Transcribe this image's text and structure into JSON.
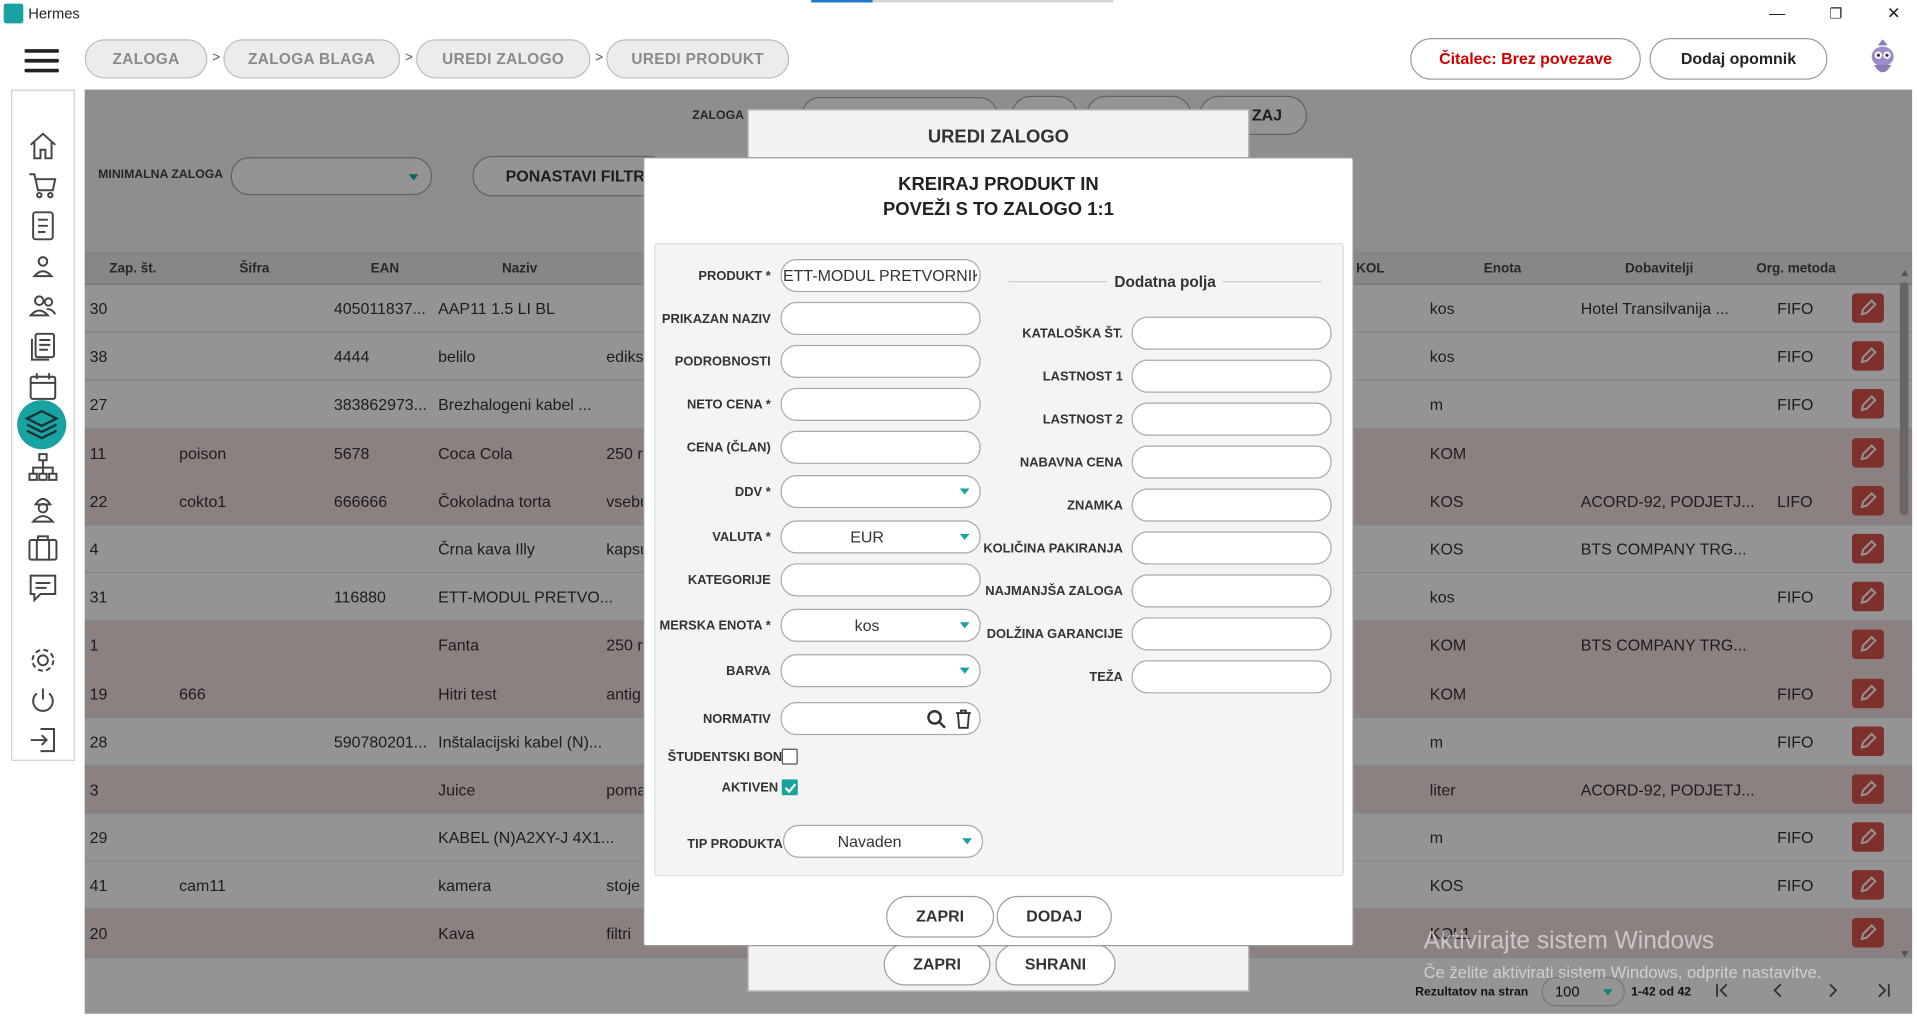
{
  "window": {
    "title": "Hermes",
    "minimize": "—",
    "restore": "❐",
    "close": "✕"
  },
  "breadcrumbs": [
    {
      "label": "ZALOGA"
    },
    {
      "label": "ZALOGA BLAGA"
    },
    {
      "label": "UREDI ZALOGO"
    },
    {
      "label": "UREDI PRODUKT"
    }
  ],
  "breadcrumb_separator": ">",
  "header": {
    "reader_status": "Čitalec: Brez povezave",
    "add_reminder": "Dodaj opomnik",
    "reader_status_color": "#d00000"
  },
  "sidebar_icons": [
    "home-icon",
    "cart-icon",
    "document-icon",
    "user-icon",
    "users-icon",
    "list-icon",
    "calendar-icon",
    "layers-icon",
    "network-icon",
    "worker-icon",
    "briefcase-icon",
    "chat-icon",
    "settings-icon",
    "power-icon",
    "logout-icon"
  ],
  "background_filters": {
    "zaloga_label": "ZALOGA P",
    "minimal_stock_label": "MINIMALNA ZALOGA",
    "reset_filters": "PONASTAVI FILTRE",
    "partial_button": "ZAJ"
  },
  "table": {
    "columns": [
      "Zap. št.",
      "Šifra",
      "EAN",
      "Naziv",
      "KOL",
      "Enota",
      "Dobavitelji",
      "Org. metoda"
    ],
    "rows": [
      {
        "no": "30",
        "sifra": "",
        "ean": "405011837...",
        "naziv": "AAP11 1.5 LI BL",
        "opis": "",
        "enota": "kos",
        "dob": "Hotel Transilvanija ...",
        "metoda": "FIFO",
        "pink": false
      },
      {
        "no": "38",
        "sifra": "",
        "ean": "4444",
        "naziv": "belilo",
        "opis": "ediks",
        "enota": "kos",
        "dob": "",
        "metoda": "FIFO",
        "pink": false
      },
      {
        "no": "27",
        "sifra": "",
        "ean": "383862973...",
        "naziv": "Brezhalogeni kabel ...",
        "opis": "",
        "enota": "m",
        "dob": "",
        "metoda": "FIFO",
        "pink": false
      },
      {
        "no": "11",
        "sifra": "poison",
        "ean": "5678",
        "naziv": "Coca Cola",
        "opis": "250 r",
        "enota": "KOM",
        "dob": "",
        "metoda": "",
        "pink": true
      },
      {
        "no": "22",
        "sifra": "cokto1",
        "ean": "666666",
        "naziv": "Čokoladna torta",
        "opis": "vsebu",
        "enota": "KOS",
        "dob": "ACORD-92, PODJETJ...",
        "metoda": "LIFO",
        "pink": true
      },
      {
        "no": "4",
        "sifra": "",
        "ean": "",
        "naziv": "Črna kava Illy",
        "opis": "kapsu",
        "enota": "KOS",
        "dob": "BTS COMPANY TRG...",
        "metoda": "",
        "pink": false
      },
      {
        "no": "31",
        "sifra": "",
        "ean": "116880",
        "naziv": "ETT-MODUL PRETVO...",
        "opis": "",
        "enota": "kos",
        "dob": "",
        "metoda": "FIFO",
        "pink": false
      },
      {
        "no": "1",
        "sifra": "",
        "ean": "",
        "naziv": "Fanta",
        "opis": "250 r",
        "enota": "KOM",
        "dob": "BTS COMPANY TRG...",
        "metoda": "",
        "pink": true
      },
      {
        "no": "19",
        "sifra": "666",
        "ean": "",
        "naziv": "Hitri test",
        "opis": "antig",
        "enota": "KOM",
        "dob": "",
        "metoda": "FIFO",
        "pink": true
      },
      {
        "no": "28",
        "sifra": "",
        "ean": "590780201...",
        "naziv": "Inštalacijski kabel (N)...",
        "opis": "",
        "enota": "m",
        "dob": "",
        "metoda": "FIFO",
        "pink": false
      },
      {
        "no": "3",
        "sifra": "",
        "ean": "",
        "naziv": "Juice",
        "opis": "poma",
        "enota": "liter",
        "dob": "ACORD-92, PODJETJ...",
        "metoda": "",
        "pink": true
      },
      {
        "no": "29",
        "sifra": "",
        "ean": "",
        "naziv": "KABEL (N)A2XY-J 4X1...",
        "opis": "",
        "enota": "m",
        "dob": "",
        "metoda": "FIFO",
        "pink": false
      },
      {
        "no": "41",
        "sifra": "cam11",
        "ean": "",
        "naziv": "kamera",
        "opis": "stoje",
        "enota": "KOS",
        "dob": "",
        "metoda": "FIFO",
        "pink": false
      },
      {
        "no": "20",
        "sifra": "",
        "ean": "",
        "naziv": "Kava",
        "opis": "filtri",
        "enota": "KOL1",
        "dob": "",
        "metoda": "",
        "pink": true
      }
    ]
  },
  "edit_stock_modal": {
    "title": "UREDI ZALOGO",
    "close": "ZAPRI",
    "save": "SHRANI"
  },
  "create_product_modal": {
    "title_line1": "KREIRAJ PRODUKT IN",
    "title_line2": "POVEŽI S TO ZALOGO 1:1",
    "left_fields": [
      {
        "label": "PRODUKT *",
        "value": "ETT-MODUL PRETVORNIK LE",
        "kind": "text"
      },
      {
        "label": "PRIKAZAN NAZIV",
        "value": "",
        "kind": "text"
      },
      {
        "label": "PODROBNOSTI",
        "value": "",
        "kind": "text"
      },
      {
        "label": "NETO CENA *",
        "value": "",
        "kind": "text"
      },
      {
        "label": "CENA (ČLAN)",
        "value": "",
        "kind": "text"
      },
      {
        "label": "DDV *",
        "value": "",
        "kind": "select"
      },
      {
        "label": "VALUTA *",
        "value": "EUR",
        "kind": "select"
      },
      {
        "label": "KATEGORIJE",
        "value": "",
        "kind": "text"
      },
      {
        "label": "MERSKA ENOTA *",
        "value": "kos",
        "kind": "select"
      },
      {
        "label": "BARVA",
        "value": "",
        "kind": "select"
      },
      {
        "label": "NORMATIV",
        "value": "",
        "kind": "search"
      }
    ],
    "student_voucher_label": "ŠTUDENTSKI BON",
    "student_voucher_checked": false,
    "active_label": "AKTIVEN",
    "active_checked": true,
    "product_type_label": "TIP PRODUKTA",
    "product_type_value": "Navaden",
    "extra_title": "Dodatna polja",
    "right_fields": [
      {
        "label": "KATALOŠKA ŠT.",
        "value": ""
      },
      {
        "label": "LASTNOST 1",
        "value": ""
      },
      {
        "label": "LASTNOST 2",
        "value": ""
      },
      {
        "label": "NABAVNA CENA",
        "value": ""
      },
      {
        "label": "ZNAMKA",
        "value": ""
      },
      {
        "label": "KOLIČINA PAKIRANJA",
        "value": ""
      },
      {
        "label": "NAJMANJŠA ZALOGA",
        "value": ""
      },
      {
        "label": "DOLŽINA GARANCIJE",
        "value": ""
      },
      {
        "label": "TEŽA",
        "value": ""
      }
    ],
    "close": "ZAPRI",
    "add": "DODAJ"
  },
  "pagination": {
    "label": "Rezultatov na stran",
    "per_page": "100",
    "range": "1-42 od 42"
  },
  "watermark": {
    "line1": "Aktivirajte sistem Windows",
    "line2": "Če želite aktivirati sistem Windows, odprite nastavitve."
  },
  "colors": {
    "accent": "#19a2a2",
    "danger": "#d9534f",
    "row_highlight": "#f2dede"
  }
}
